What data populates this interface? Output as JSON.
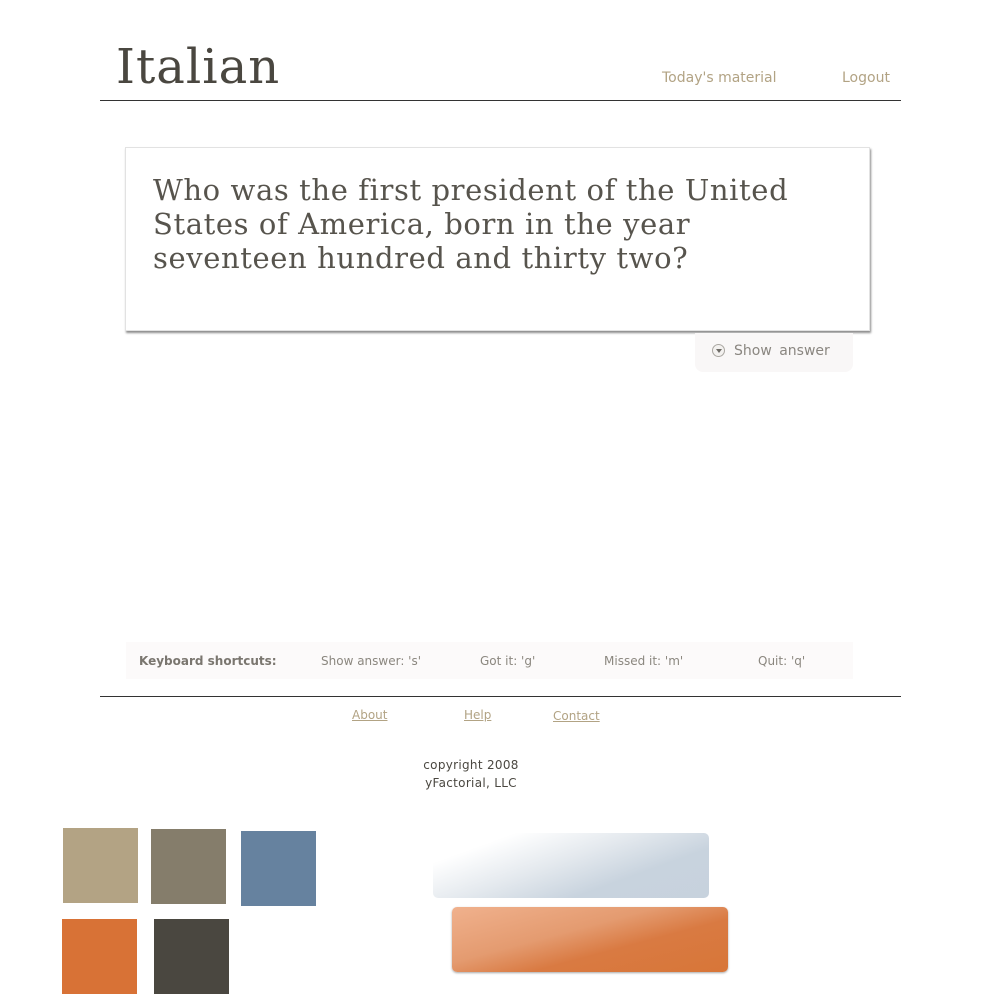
{
  "header": {
    "title": "Italian",
    "nav": [
      {
        "label": "Today's material"
      },
      {
        "label": "Logout"
      }
    ]
  },
  "card": {
    "question": "Who was the first president of the United States of America, born in the year seventeen hundred and thirty two?"
  },
  "show_answer": {
    "label": "Show answer",
    "icon": "chevron-down-circle-icon"
  },
  "shortcuts": {
    "heading": "Keyboard shortcuts:",
    "items": [
      {
        "label": "Show answer: 's'"
      },
      {
        "label": "Got it: 'g'"
      },
      {
        "label": "Missed it: 'm'"
      },
      {
        "label": "Quit: 'q'"
      }
    ]
  },
  "footer": {
    "links": [
      {
        "label": "About"
      },
      {
        "label": "Help"
      },
      {
        "label": "Contact"
      }
    ],
    "copyright_line1": "copyright 2008",
    "copyright_line2": "yFactorial, LLC"
  },
  "palette": {
    "tan": "#b3a384",
    "taupe": "#857d6b",
    "slate_blue": "#66829f",
    "orange": "#d87236",
    "charcoal": "#4a4740",
    "light_blue": "#c7d2dd",
    "light_orange": "#e8a47b"
  }
}
